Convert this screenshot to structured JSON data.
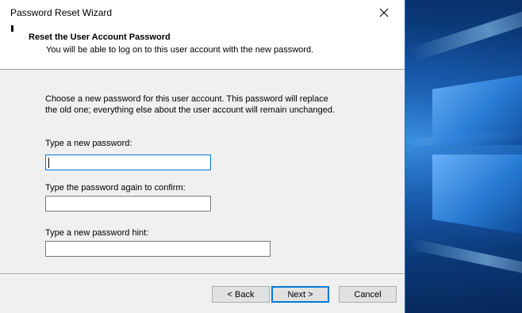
{
  "window": {
    "title": "Password Reset Wizard"
  },
  "header": {
    "title": "Reset the User Account Password",
    "subtitle": "You will be able to log on to this user account with the new password."
  },
  "body": {
    "intro_line1": "Choose a new password for this user account. This password will replace",
    "intro_line2": "the old one; everything else about the user account will remain unchanged."
  },
  "fields": {
    "new_password": {
      "label": "Type a new password:",
      "value": ""
    },
    "confirm_password": {
      "label": "Type the password again to confirm:",
      "value": ""
    },
    "hint": {
      "label": "Type a new password hint:",
      "value": ""
    }
  },
  "buttons": {
    "back": "< Back",
    "next": "Next >",
    "cancel": "Cancel"
  },
  "colors": {
    "accent": "#0078d7",
    "dialog_bg": "#f0f0f0",
    "desktop_blue": "#0b3a7a"
  },
  "icons": {
    "close": "close-icon"
  }
}
